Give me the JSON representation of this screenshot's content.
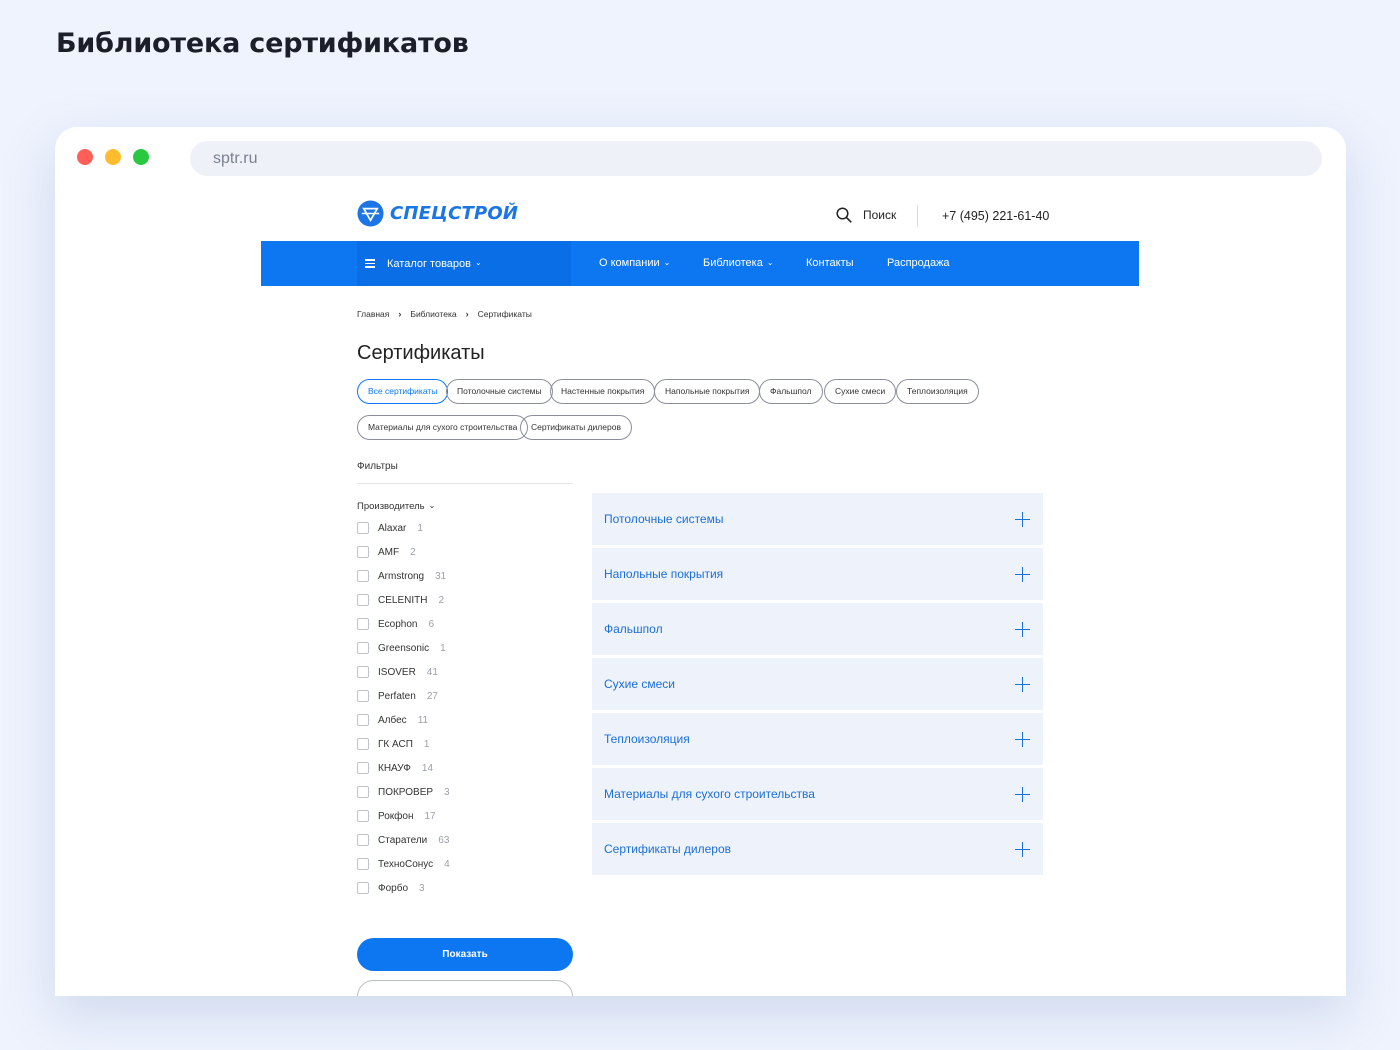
{
  "page_heading": "Библиотека сертификатов",
  "browser": {
    "url": "sptr.ru"
  },
  "site": {
    "logo_text": "СПЕЦСТРОЙ",
    "search_label": "Поиск",
    "phone": "+7 (495) 221-61-40",
    "nav": {
      "catalog": "Каталог товаров",
      "items": [
        "О компании",
        "Библиотека",
        "Контакты",
        "Распродажа"
      ]
    },
    "breadcrumb": [
      "Главная",
      "Библиотека",
      "Сертификаты"
    ],
    "title": "Сертификаты",
    "chips": [
      "Все сертификаты",
      "Потолочные системы",
      "Настенные покрытия",
      "Напольные покрытия",
      "Фальшпол",
      "Сухие смеси",
      "Теплоизоляция",
      "Материалы для сухого строительства",
      "Сертификаты дилеров"
    ],
    "active_chip": "Все сертификаты",
    "filters": {
      "title": "Фильтры",
      "manufacturer_label": "Производитель",
      "manufacturers": [
        {
          "name": "Alaxar",
          "count": "1"
        },
        {
          "name": "AMF",
          "count": "2"
        },
        {
          "name": "Armstrong",
          "count": "31"
        },
        {
          "name": "CELENITH",
          "count": "2"
        },
        {
          "name": "Ecophon",
          "count": "6"
        },
        {
          "name": "Greensonic",
          "count": "1"
        },
        {
          "name": "ISOVER",
          "count": "41"
        },
        {
          "name": "Perfaten",
          "count": "27"
        },
        {
          "name": "Албес",
          "count": "11"
        },
        {
          "name": "ГК АСП",
          "count": "1"
        },
        {
          "name": "КНАУФ",
          "count": "14"
        },
        {
          "name": "ПОКРОВЕР",
          "count": "3"
        },
        {
          "name": "Рокфон",
          "count": "17"
        },
        {
          "name": "Старатели",
          "count": "63"
        },
        {
          "name": "ТехноСонус",
          "count": "4"
        },
        {
          "name": "Форбо",
          "count": "3"
        }
      ],
      "show_button": "Показать"
    },
    "accordion": [
      "Потолочные системы",
      "Напольные покрытия",
      "Фальшпол",
      "Сухие смеси",
      "Теплоизоляция",
      "Материалы для сухого строительства",
      "Сертификаты дилеров"
    ]
  },
  "colors": {
    "accent": "#0d77f2",
    "background": "#eef3fd",
    "accordion_bg": "#eef2fb"
  }
}
